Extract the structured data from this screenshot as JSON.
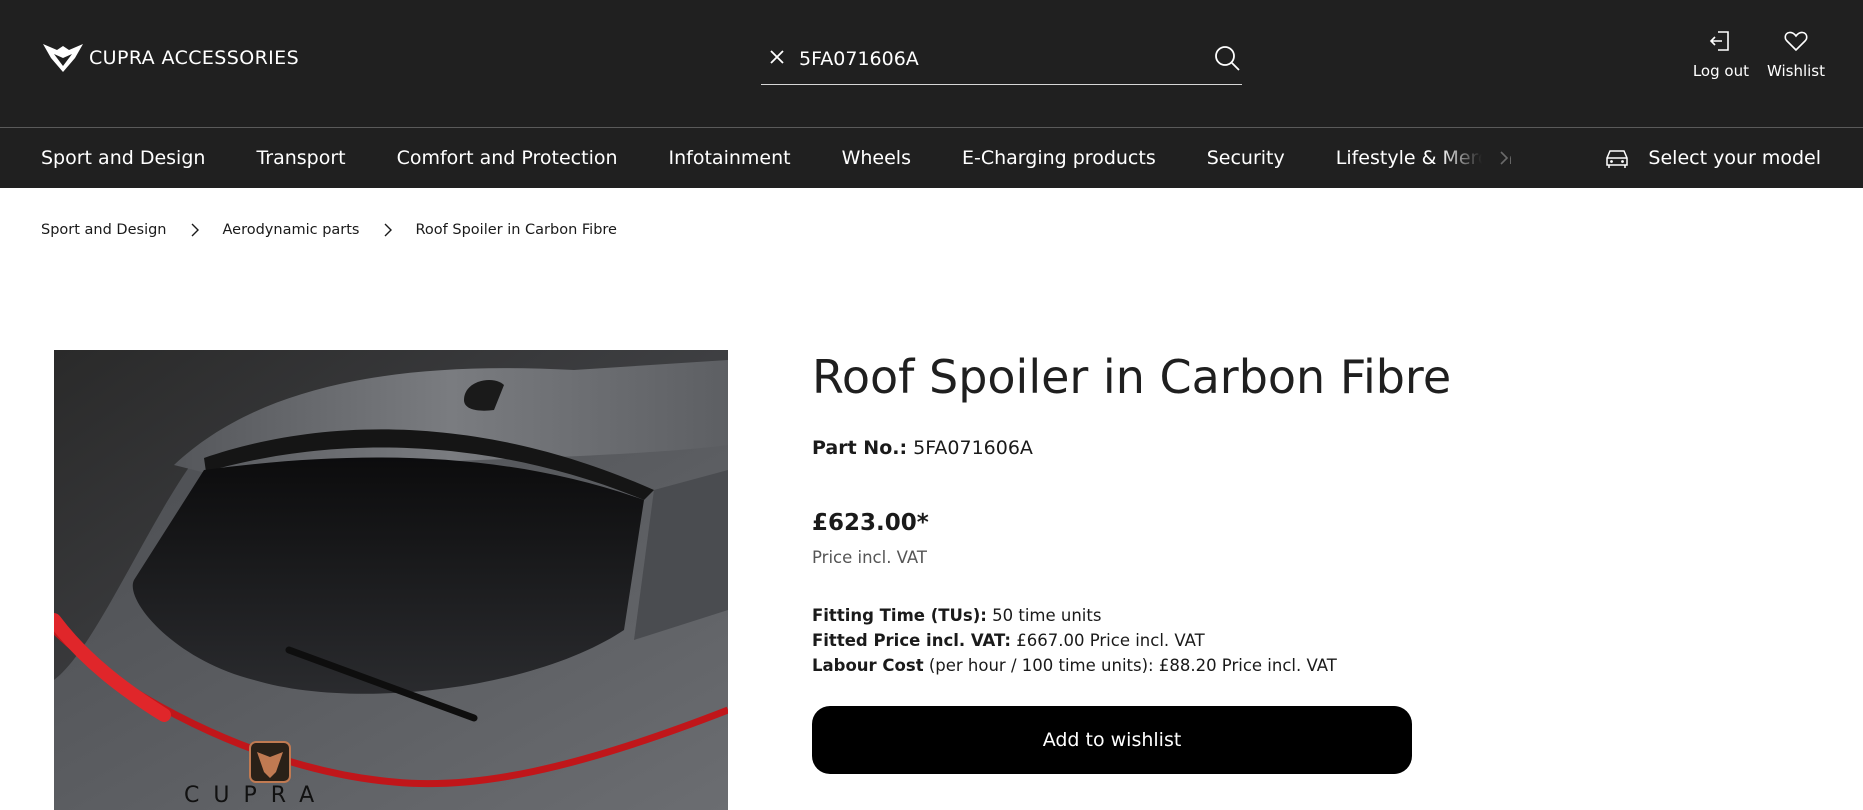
{
  "header": {
    "logo_text": "CUPRA ACCESSORIES",
    "search_value": "5FA071606A",
    "logout_label": "Log out",
    "wishlist_label": "Wishlist"
  },
  "nav": {
    "items": [
      "Sport and Design",
      "Transport",
      "Comfort and Protection",
      "Infotainment",
      "Wheels",
      "E-Charging products",
      "Security",
      "Lifestyle & Merchandise"
    ],
    "select_model": "Select your model"
  },
  "breadcrumb": [
    "Sport and Design",
    "Aerodynamic parts",
    "Roof Spoiler in Carbon Fibre"
  ],
  "product": {
    "title": "Roof Spoiler in Carbon Fibre",
    "part_no_label": "Part No.:",
    "part_no": "5FA071606A",
    "price": "£623.00*",
    "price_note": "Price incl. VAT",
    "fitting_time_label": "Fitting Time (TUs):",
    "fitting_time_value": "50 time units",
    "fitted_price_label": "Fitted Price incl. VAT:",
    "fitted_price_value": "£667.00 Price incl. VAT",
    "labour_cost_label": "Labour Cost",
    "labour_cost_value": "(per hour / 100 time units): £88.20 Price incl. VAT",
    "add_to_wishlist": "Add to wishlist"
  },
  "colors": {
    "header_bg": "#202020",
    "button_bg": "#000000",
    "accent_copper": "#c07a52"
  }
}
